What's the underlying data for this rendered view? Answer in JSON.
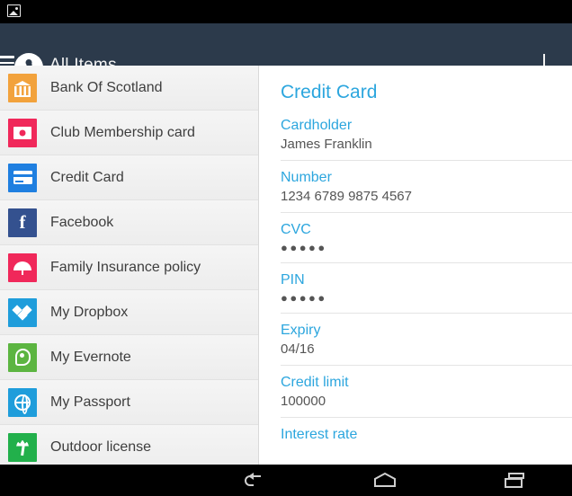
{
  "statusbar": {
    "icon": "image-icon"
  },
  "appbar": {
    "menu_icon": "hamburger-menu-icon",
    "logo_icon": "app-keyhole-logo-icon",
    "title": "All Items",
    "add_icon": "plus-icon",
    "background_color": "#2c3a4b"
  },
  "list": {
    "items": [
      {
        "label": "Bank Of Scotland",
        "icon": "bank-icon",
        "icon_color": "#f2a23c"
      },
      {
        "label": "Club Membership card",
        "icon": "membership-card-icon",
        "icon_color": "#f2records"
      },
      {
        "label": "Credit Card",
        "icon": "credit-card-icon",
        "icon_color": "#1f7fe0"
      },
      {
        "label": "Facebook",
        "icon": "facebook-icon",
        "icon_color": "#34518f"
      },
      {
        "label": "Family Insurance policy",
        "icon": "umbrella-icon",
        "icon_color": "#f0285a"
      },
      {
        "label": "My Dropbox",
        "icon": "dropbox-icon",
        "icon_color": "#1f9ddb"
      },
      {
        "label": "My Evernote",
        "icon": "evernote-icon",
        "icon_color": "#5cb541"
      },
      {
        "label": "My Passport",
        "icon": "globe-icon",
        "icon_color": "#1f9ddb"
      },
      {
        "label": "Outdoor license",
        "icon": "palm-tree-icon",
        "icon_color": "#22b04b"
      }
    ]
  },
  "detail": {
    "title": "Credit Card",
    "accent_color": "#2ca6de",
    "fields": [
      {
        "label": "Cardholder",
        "value": "James Franklin",
        "masked": false
      },
      {
        "label": "Number",
        "value": "1234 6789 9875 4567",
        "masked": false
      },
      {
        "label": "CVC",
        "value": "●●●●●",
        "masked": true
      },
      {
        "label": "PIN",
        "value": "●●●●●",
        "masked": true
      },
      {
        "label": "Expiry",
        "value": "04/16",
        "masked": false
      },
      {
        "label": "Credit limit",
        "value": "100000",
        "masked": false
      },
      {
        "label": "Interest rate",
        "value": "",
        "masked": false
      }
    ]
  },
  "navbar": {
    "back_icon": "back-arrow-icon",
    "home_icon": "home-icon",
    "recents_icon": "recent-apps-icon"
  }
}
